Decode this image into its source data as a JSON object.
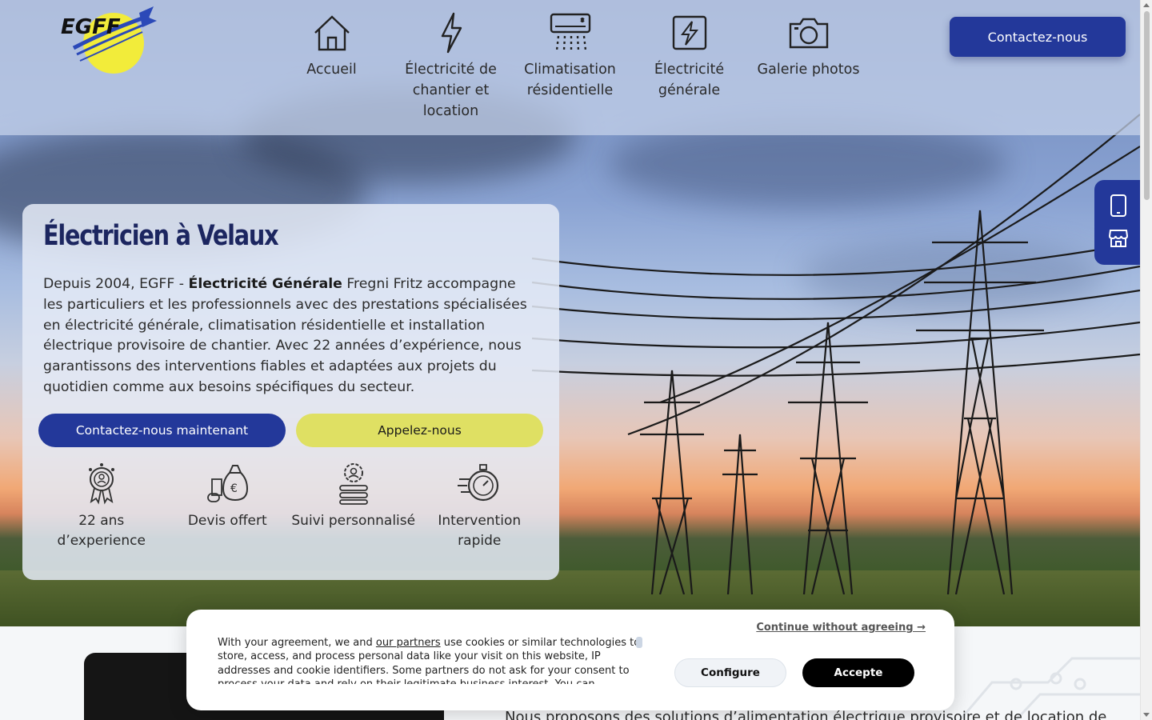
{
  "header": {
    "logo_text": "EGFF",
    "nav": [
      {
        "label": "Accueil",
        "icon": "house-icon"
      },
      {
        "label": "Électricité de chantier et location",
        "icon": "lightning-icon"
      },
      {
        "label": "Climatisation résidentielle",
        "icon": "air-conditioner-icon"
      },
      {
        "label": "Électricité générale",
        "icon": "electric-panel-icon"
      },
      {
        "label": "Galerie photos",
        "icon": "camera-icon"
      }
    ],
    "contact_button": "Contactez-nous"
  },
  "side_tab": {
    "icons": [
      "phone-icon",
      "store-icon"
    ]
  },
  "hero": {
    "title": "Électricien à Velaux",
    "text_before": "Depuis 2004, EGFF - ",
    "text_bold": "Électricité Générale",
    "text_after": " Fregni Fritz accompagne les particuliers et les professionnels avec des prestations spécialisées en électricité générale, climatisation résidentielle et installation électrique provisoire de chantier. Avec 22 années d’expérience, nous garantissons des interventions fiables et adaptées aux projets du quotidien comme aux besoins spécifiques du secteur.",
    "primary_button": "Contactez-nous maintenant",
    "secondary_button": "Appelez-nous",
    "features": [
      {
        "label": "22 ans d’experience",
        "icon": "award-icon"
      },
      {
        "label": "Devis offert",
        "icon": "money-bag-icon"
      },
      {
        "label": "Suivi personnalisé",
        "icon": "support-icon"
      },
      {
        "label": "Intervention rapide",
        "icon": "stopwatch-icon"
      }
    ]
  },
  "lower": {
    "text": "Nous proposons des solutions d’alimentation électrique provisoire et de location de"
  },
  "cookie": {
    "continue_link": "Continue without agreeing →",
    "text_before": "With your agreement, we and ",
    "text_link": "our partners",
    "text_after": " use cookies or similar technologies to store, access, and process personal data like your visit on this website, IP addresses and cookie identifiers. Some partners do not ask for your consent to process your data and rely on their legitimate business interest. You can",
    "configure_button": "Configure",
    "accept_button": "Accepte"
  },
  "colors": {
    "brand_blue": "#23389a",
    "accent_yellow": "#dfe063",
    "title_navy": "#1c2660"
  }
}
